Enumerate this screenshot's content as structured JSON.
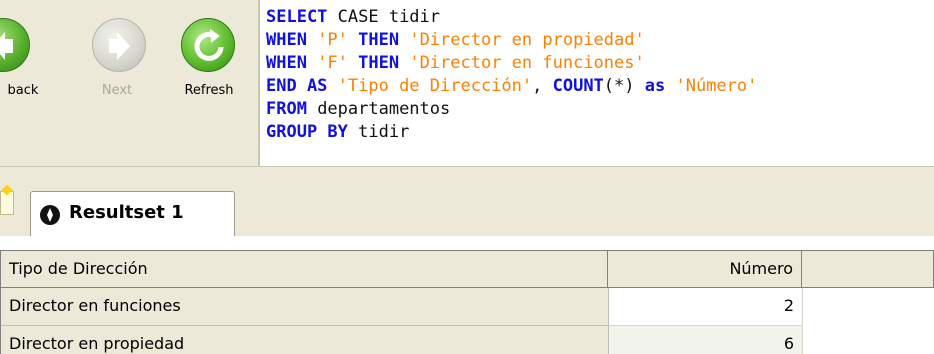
{
  "toolbar": {
    "back_label": "back",
    "next_label": "Next",
    "refresh_label": "Refresh"
  },
  "editor": {
    "lines": [
      [
        {
          "t": "kw",
          "v": "SELECT"
        },
        {
          "t": "txt",
          "v": " CASE tidir"
        }
      ],
      [
        {
          "t": "kw",
          "v": "WHEN"
        },
        {
          "t": "str",
          "v": " 'P' "
        },
        {
          "t": "kw",
          "v": "THEN"
        },
        {
          "t": "str",
          "v": " 'Director en propiedad'"
        }
      ],
      [
        {
          "t": "kw",
          "v": "WHEN"
        },
        {
          "t": "str",
          "v": " 'F' "
        },
        {
          "t": "kw",
          "v": "THEN"
        },
        {
          "t": "str",
          "v": " 'Director en funciones'"
        }
      ],
      [
        {
          "t": "kw",
          "v": "END AS"
        },
        {
          "t": "str",
          "v": " 'Tipo de Dirección'"
        },
        {
          "t": "txt",
          "v": ", "
        },
        {
          "t": "kw",
          "v": "COUNT"
        },
        {
          "t": "txt",
          "v": "(*) "
        },
        {
          "t": "kw",
          "v": "as"
        },
        {
          "t": "str",
          "v": " 'Número'"
        }
      ],
      [
        {
          "t": "kw",
          "v": "FROM"
        },
        {
          "t": "txt",
          "v": " departamentos"
        }
      ],
      [
        {
          "t": "kw",
          "v": "GROUP BY"
        },
        {
          "t": "txt",
          "v": " tidir"
        }
      ]
    ]
  },
  "tabs": {
    "resultset_label": "Resultset 1"
  },
  "grid": {
    "columns": [
      "Tipo de Dirección",
      "Número"
    ],
    "rows": [
      [
        "Director en funciones",
        "2"
      ],
      [
        "Director en propiedad",
        "6"
      ]
    ]
  },
  "colors": {
    "keyword": "#1010e0",
    "string": "#ff8000",
    "text": "#111111",
    "chrome": "#ece9d8"
  },
  "icons": [
    "back-arrow-icon",
    "next-arrow-icon",
    "refresh-icon",
    "new-tab-icon",
    "resultset-icon"
  ]
}
